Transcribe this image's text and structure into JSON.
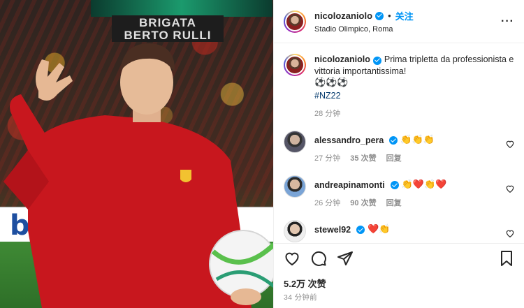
{
  "post": {
    "photo_alt": "Player in red training top holding match ball",
    "stand_banner": "BRIGATA\nBERTO RULLI",
    "ad_text": "bwin"
  },
  "header": {
    "username": "nicolozaniolo",
    "dot": "•",
    "follow_label": "关注",
    "location": "Stadio Olimpico, Roma",
    "more_label": "···"
  },
  "caption": {
    "username": "nicolozaniolo",
    "text": "Prima tripletta da professionista e vittoria importantissima!",
    "emojis": "⚽⚽⚽",
    "hashtag": "#NZ22",
    "time": "28 分钟"
  },
  "comments": [
    {
      "username": "alessandro_pera",
      "emojis": "👏👏👏",
      "time": "27 分钟",
      "likes": "35 次赞",
      "reply": "回复"
    },
    {
      "username": "andreapinamonti",
      "emojis": "👏❤️👏❤️",
      "time": "26 分钟",
      "likes": "90 次赞",
      "reply": "回复"
    },
    {
      "username": "stewel92",
      "emojis": "❤️👏",
      "time": "",
      "likes": "",
      "reply": ""
    }
  ],
  "likes": "5.2万 次赞",
  "post_time": "34 分钟前",
  "colors": {
    "accent": "#0095f6",
    "hashtag": "#00376b",
    "muted": "#8e8e8e"
  }
}
